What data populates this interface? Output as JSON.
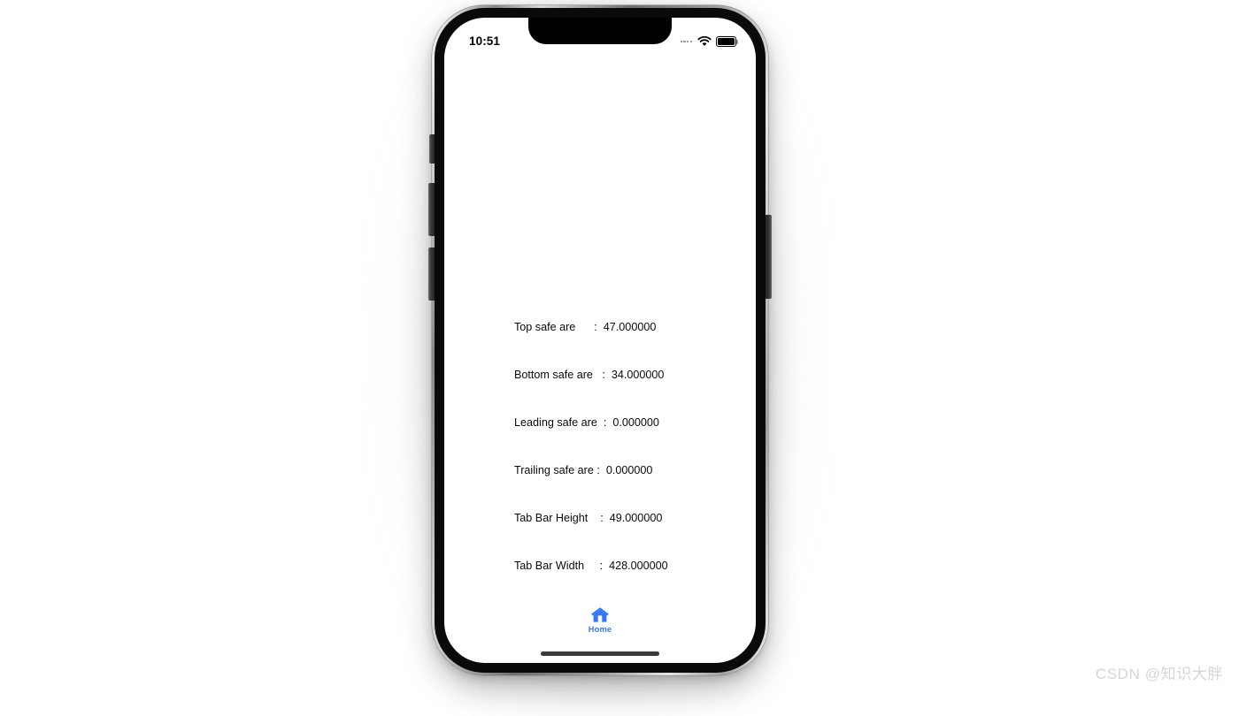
{
  "page": {
    "background_color": "#ffffff",
    "watermark": "CSDN @知识大胖"
  },
  "device": {
    "name": "iPhone 12 Pro Max mockup",
    "frame_color": "#0a0a0b",
    "rim_color": "#b9b9bb",
    "screen_background": "#ffffff"
  },
  "status_bar": {
    "time": "10:51",
    "cellular_icon": "cellular-dots-icon",
    "wifi_icon": "wifi-icon",
    "battery_icon": "battery-full-icon",
    "battery_level_percent": 100
  },
  "content": {
    "rows": [
      {
        "label": "Top safe are",
        "separator": ":",
        "value": "47.000000",
        "line": "Top safe are      :  47.000000"
      },
      {
        "label": "Bottom safe are",
        "separator": ":",
        "value": "34.000000",
        "line": "Bottom safe are   :  34.000000"
      },
      {
        "label": "Leading safe are",
        "separator": ":",
        "value": "0.000000",
        "line": "Leading safe are  :  0.000000"
      },
      {
        "label": "Trailing safe are",
        "separator": ":",
        "value": "0.000000",
        "line": "Trailing safe are :  0.000000"
      },
      {
        "label": "Tab Bar Height",
        "separator": ":",
        "value": "49.000000",
        "line": "Tab Bar Height    :  49.000000"
      },
      {
        "label": "Tab Bar Width",
        "separator": ":",
        "value": "428.000000",
        "line": "Tab Bar Width     :  428.000000"
      }
    ]
  },
  "tab_bar": {
    "accent_color": "#3478f6",
    "items": [
      {
        "icon": "home-icon",
        "label": "Home",
        "selected": true
      }
    ]
  },
  "home_indicator": {
    "color": "#3a3a3c"
  }
}
